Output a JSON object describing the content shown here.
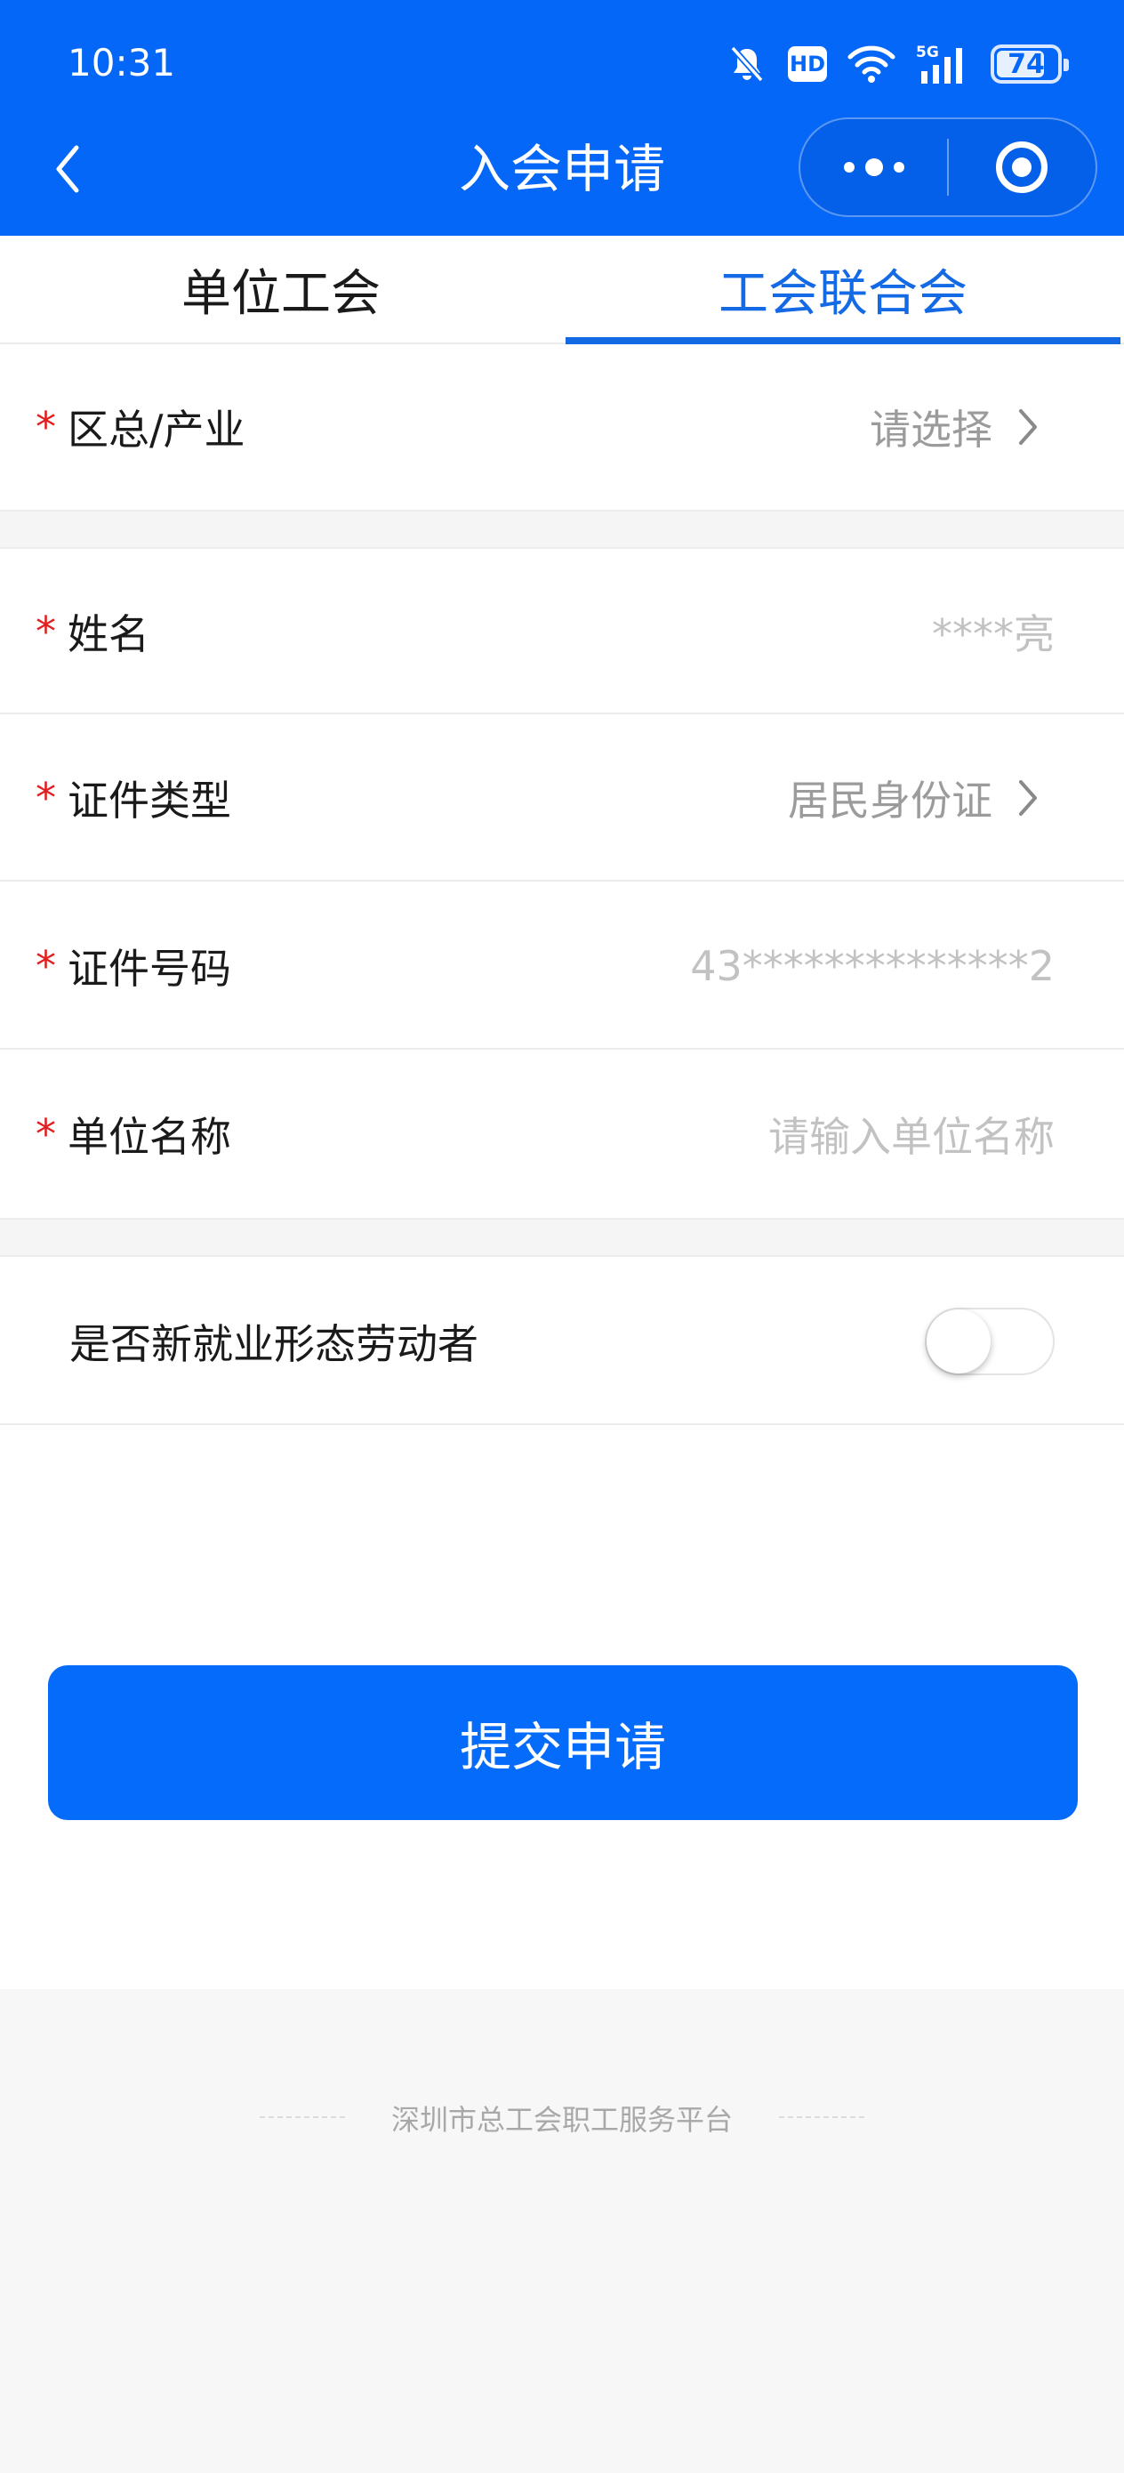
{
  "status_bar": {
    "time": "10:31",
    "icons": [
      "bell-muted-icon",
      "hd-icon",
      "wifi-icon",
      "5g-signal-icon",
      "battery-icon"
    ],
    "hd": "HD",
    "network": "5G",
    "battery": "74"
  },
  "nav": {
    "title": "入会申请",
    "back_icon": "chevron-left-icon",
    "more_icon": "more-dots-icon",
    "close_icon": "target-circle-icon"
  },
  "tabs": [
    {
      "label": "单位工会",
      "active": false
    },
    {
      "label": "工会联合会",
      "active": true
    }
  ],
  "form": {
    "district": {
      "label": "区总/产业",
      "required": true,
      "value": "请选择"
    },
    "name": {
      "label": "姓名",
      "required": true,
      "value": "****亮"
    },
    "id_type": {
      "label": "证件类型",
      "required": true,
      "value": "居民身份证"
    },
    "id_number": {
      "label": "证件号码",
      "required": true,
      "value": "43**************2"
    },
    "company": {
      "label": "单位名称",
      "required": true,
      "placeholder": "请输入单位名称"
    },
    "new_employment": {
      "label": "是否新就业形态劳动者",
      "checked": false
    }
  },
  "required_mark": "*",
  "submit_label": "提交申请",
  "footer": {
    "text": "深圳市总工会职工服务平台"
  },
  "colors": {
    "primary": "#0567f7",
    "tab_active": "#1469e5",
    "required": "#e02020",
    "placeholder": "#9b9b9b"
  }
}
